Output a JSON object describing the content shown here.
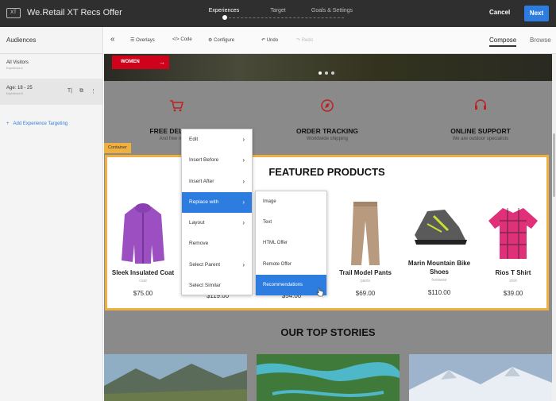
{
  "topbar": {
    "badge": "XT",
    "title": "We.Retail XT Recs Offer",
    "steps": [
      "Experiences",
      "Target",
      "Goals & Settings"
    ],
    "active_step": "Experiences",
    "cancel": "Cancel",
    "next": "Next"
  },
  "sidebar": {
    "heading": "Audiences",
    "experiences": [
      {
        "name": "All Visitors",
        "sub": "Experience A",
        "selected": false
      },
      {
        "name": "Age: 18 - 25",
        "sub": "Experience B",
        "selected": true
      }
    ],
    "add_targeting": "Add Experience Targeting"
  },
  "toolbar": {
    "overlays": "Overlays",
    "code": "Code",
    "configure": "Configure",
    "undo": "Undo",
    "redo": "Redo",
    "compose": "Compose",
    "browse": "Browse"
  },
  "page": {
    "hero_button": "WOMEN",
    "features": [
      {
        "icon": "cart-icon",
        "title": "FREE DELIVERY",
        "sub": "And free returns"
      },
      {
        "icon": "compass-icon",
        "title": "ORDER TRACKING",
        "sub": "Worldwide shipping"
      },
      {
        "icon": "headset-icon",
        "title": "ONLINE SUPPORT",
        "sub": "We are outdoor specialists"
      }
    ],
    "container_tag": "Container",
    "featured_title": "FEATURED PRODUCTS",
    "products": [
      {
        "name": "Sleek Insulated Coat",
        "category": "coat",
        "price": "$75.00"
      },
      {
        "name": "",
        "category": "",
        "price": "$119.00"
      },
      {
        "name": "",
        "category": "",
        "price": "$54.00"
      },
      {
        "name": "Trail Model Pants",
        "category": "pants",
        "price": "$69.00"
      },
      {
        "name": "Marin Mountain Bike Shoes",
        "category": "footwear",
        "price": "$110.00"
      },
      {
        "name": "Rios T Shirt",
        "category": "shirt",
        "price": "$39.00"
      }
    ],
    "stories_title": "OUR TOP STORIES"
  },
  "context_menu": {
    "items": [
      {
        "label": "Edit",
        "submenu": true
      },
      {
        "label": "Insert Before",
        "submenu": true
      },
      {
        "label": "Insert After",
        "submenu": true
      },
      {
        "label": "Replace with",
        "submenu": true,
        "highlighted": true
      },
      {
        "label": "Layout",
        "submenu": true
      },
      {
        "label": "Remove",
        "submenu": false
      },
      {
        "label": "Select Parent",
        "submenu": true
      },
      {
        "label": "Select Similar",
        "submenu": false
      }
    ]
  },
  "submenu": {
    "items": [
      {
        "label": "Image"
      },
      {
        "label": "Text"
      },
      {
        "label": "HTML Offer"
      },
      {
        "label": "Remote Offer"
      },
      {
        "label": "Recommendations",
        "highlighted": true
      }
    ]
  },
  "colors": {
    "accent": "#2d7de0",
    "container": "#f0b040",
    "brand_red": "#d0021b"
  }
}
